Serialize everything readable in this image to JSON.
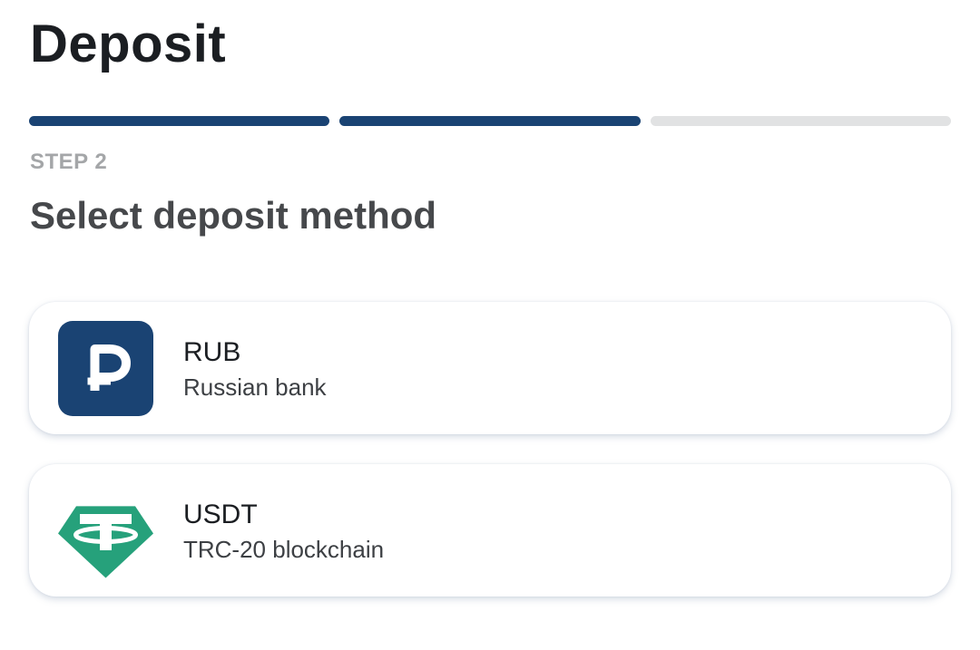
{
  "header": {
    "title": "Deposit"
  },
  "progress": {
    "total_steps": 3,
    "completed_steps": 2,
    "active_color": "#1a4373",
    "inactive_color": "#e1e2e3"
  },
  "step": {
    "label": "STEP 2",
    "title": "Select deposit method"
  },
  "methods": [
    {
      "name": "RUB",
      "description": "Russian bank",
      "icon": "ruble-icon",
      "icon_color": "#1a4373"
    },
    {
      "name": "USDT",
      "description": "TRC-20 blockchain",
      "icon": "tether-icon",
      "icon_color": "#26a17b"
    }
  ]
}
